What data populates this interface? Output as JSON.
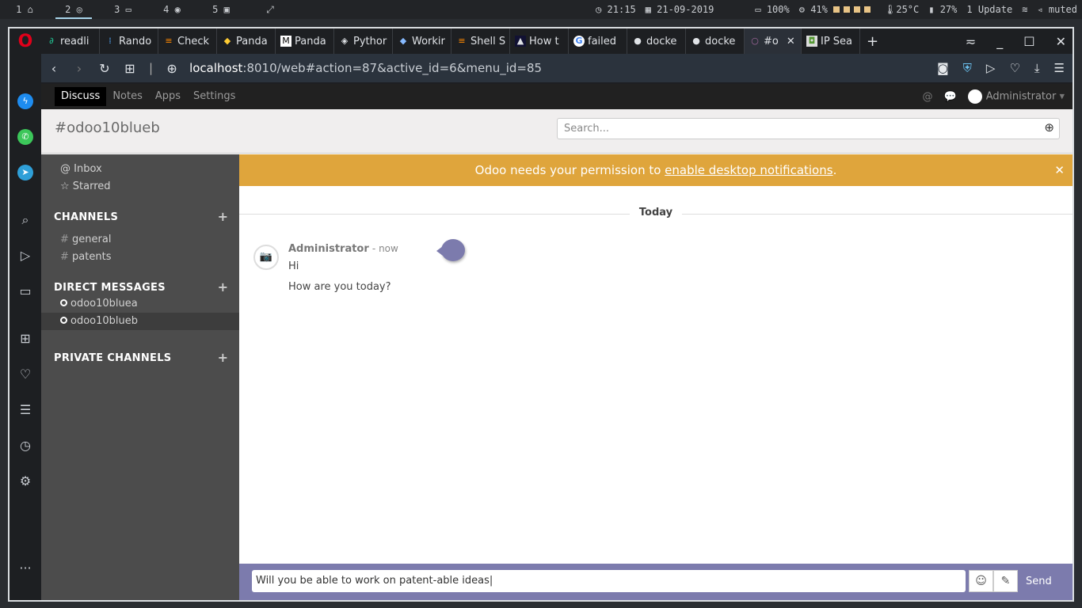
{
  "topbar": {
    "workspaces": [
      "1",
      "2",
      "3",
      "4",
      "5"
    ],
    "workspace_icons": [
      "home-icon",
      "chrome-icon",
      "folder-icon",
      "spotify-icon",
      "terminal-icon"
    ],
    "time": "21:15",
    "date": "21-09-2019",
    "battery": "100%",
    "cpu": "41%",
    "temp": "25°C",
    "memory": "27%",
    "updates": "1 Update",
    "volume": "muted"
  },
  "browser": {
    "tabs": [
      "readli",
      "Rando",
      "Check",
      "Panda",
      "Panda",
      "Pythor",
      "Workir",
      "Shell S",
      "How t",
      "failed",
      "docke",
      "docke",
      "#o",
      "IP Sea"
    ],
    "url_host": "localhost",
    "url_rest": ":8010/web#action=87&active_id=6&menu_id=85"
  },
  "odoo": {
    "nav": [
      "Discuss",
      "Notes",
      "Apps",
      "Settings"
    ],
    "user": "Administrator",
    "channel_title": "#odoo10blueb",
    "search_placeholder": "Search...",
    "sidebar": {
      "inbox": "Inbox",
      "starred": "Starred",
      "channels_head": "CHANNELS",
      "channels": [
        "general",
        "patents"
      ],
      "dm_head": "DIRECT MESSAGES",
      "dms": [
        "odoo10bluea",
        "odoo10blueb"
      ],
      "private_head": "PRIVATE CHANNELS"
    },
    "banner": {
      "before": "Odoo needs your permission to ",
      "link": "enable desktop notifications",
      "after": "."
    },
    "today": "Today",
    "message": {
      "author": "Administrator",
      "time": "- now",
      "lines": [
        "Hi",
        "How are you today?"
      ]
    },
    "composer": {
      "value": "Will you be able to work on patent-able ideas",
      "send": "Send"
    }
  },
  "colors": {
    "accent": "#7c7bad",
    "banner": "#dfa53c"
  }
}
